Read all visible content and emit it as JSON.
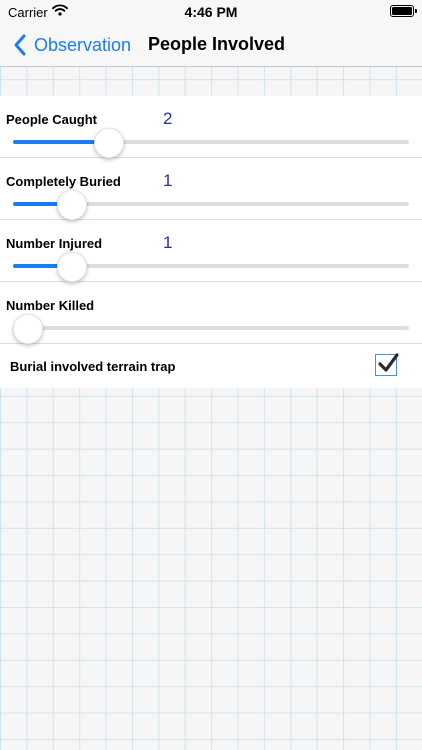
{
  "status_bar": {
    "carrier": "Carrier",
    "time": "4:46 PM"
  },
  "nav": {
    "back_label": "Observation",
    "title": "People Involved"
  },
  "sliders": [
    {
      "label": "People Caught",
      "value": "2",
      "level": 0.22
    },
    {
      "label": "Completely Buried",
      "value": "1",
      "level": 0.12
    },
    {
      "label": "Number Injured",
      "value": "1",
      "level": 0.12
    },
    {
      "label": "Number Killed",
      "value": "",
      "level": 0.0
    }
  ],
  "checkbox": {
    "label": "Burial involved terrain trap",
    "checked": true
  },
  "colors": {
    "accent": "#1a7cf5",
    "value_text": "#2b2baf"
  }
}
